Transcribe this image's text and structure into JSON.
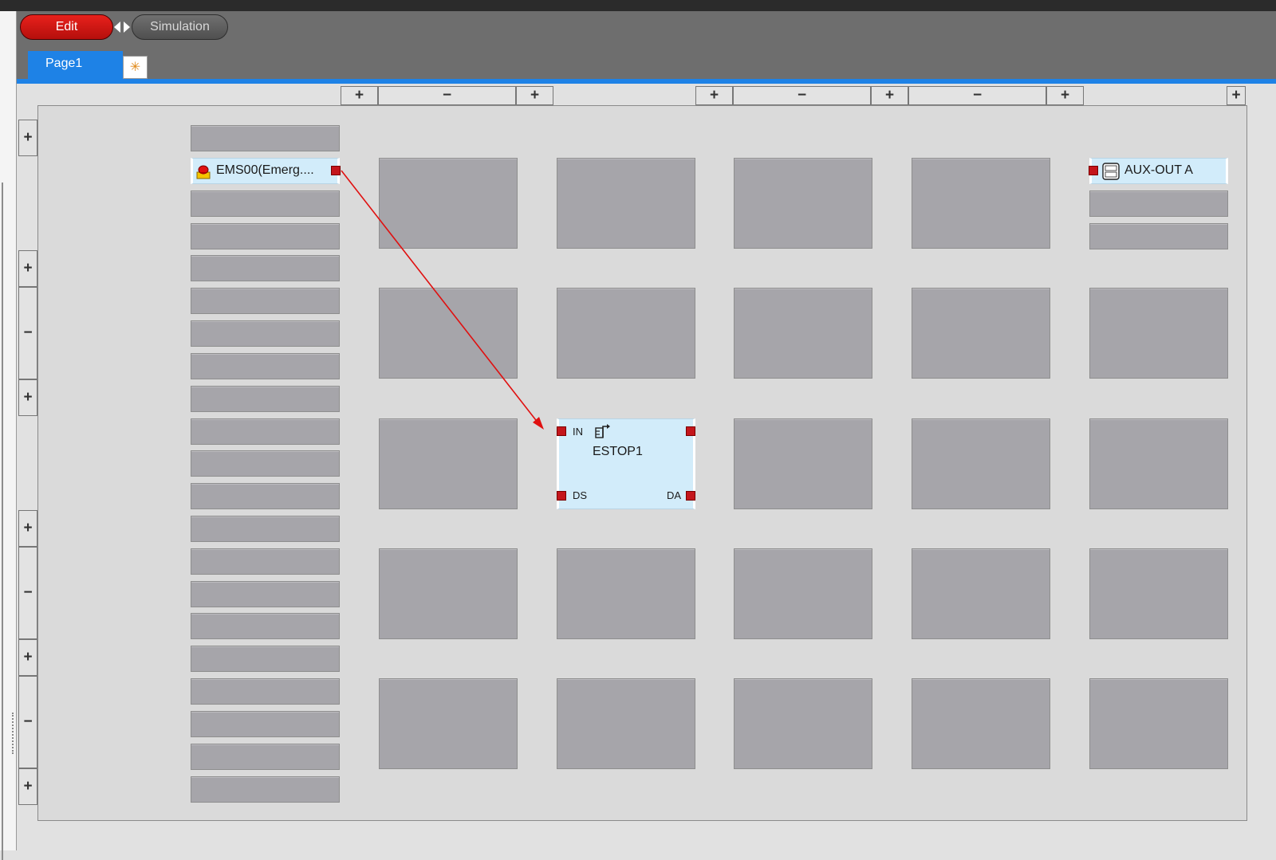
{
  "modes": {
    "edit_label": "Edit",
    "simulation_label": "Simulation"
  },
  "tabs": [
    {
      "label": "Page1"
    }
  ],
  "new_tab_icon": "sparkle-icon",
  "controls": {
    "plus": "+",
    "minus": "−"
  },
  "blocks": {
    "input": {
      "label": "EMS00(Emerg....",
      "icon": "emergency-stop-icon"
    },
    "function": {
      "title": "ESTOP1",
      "icon": "estop-function-icon",
      "ports": {
        "in": "IN",
        "ds": "DS",
        "da": "DA"
      }
    },
    "output": {
      "label": "AUX-OUT A",
      "icon": "aux-out-icon"
    }
  },
  "colors": {
    "edit_mode": "#d81a16",
    "tab_active": "#1e82e6",
    "port": "#c4161c",
    "wire": "#e01010",
    "block_fill": "#d2ecfa",
    "empty_slot": "#a6a5aa"
  }
}
